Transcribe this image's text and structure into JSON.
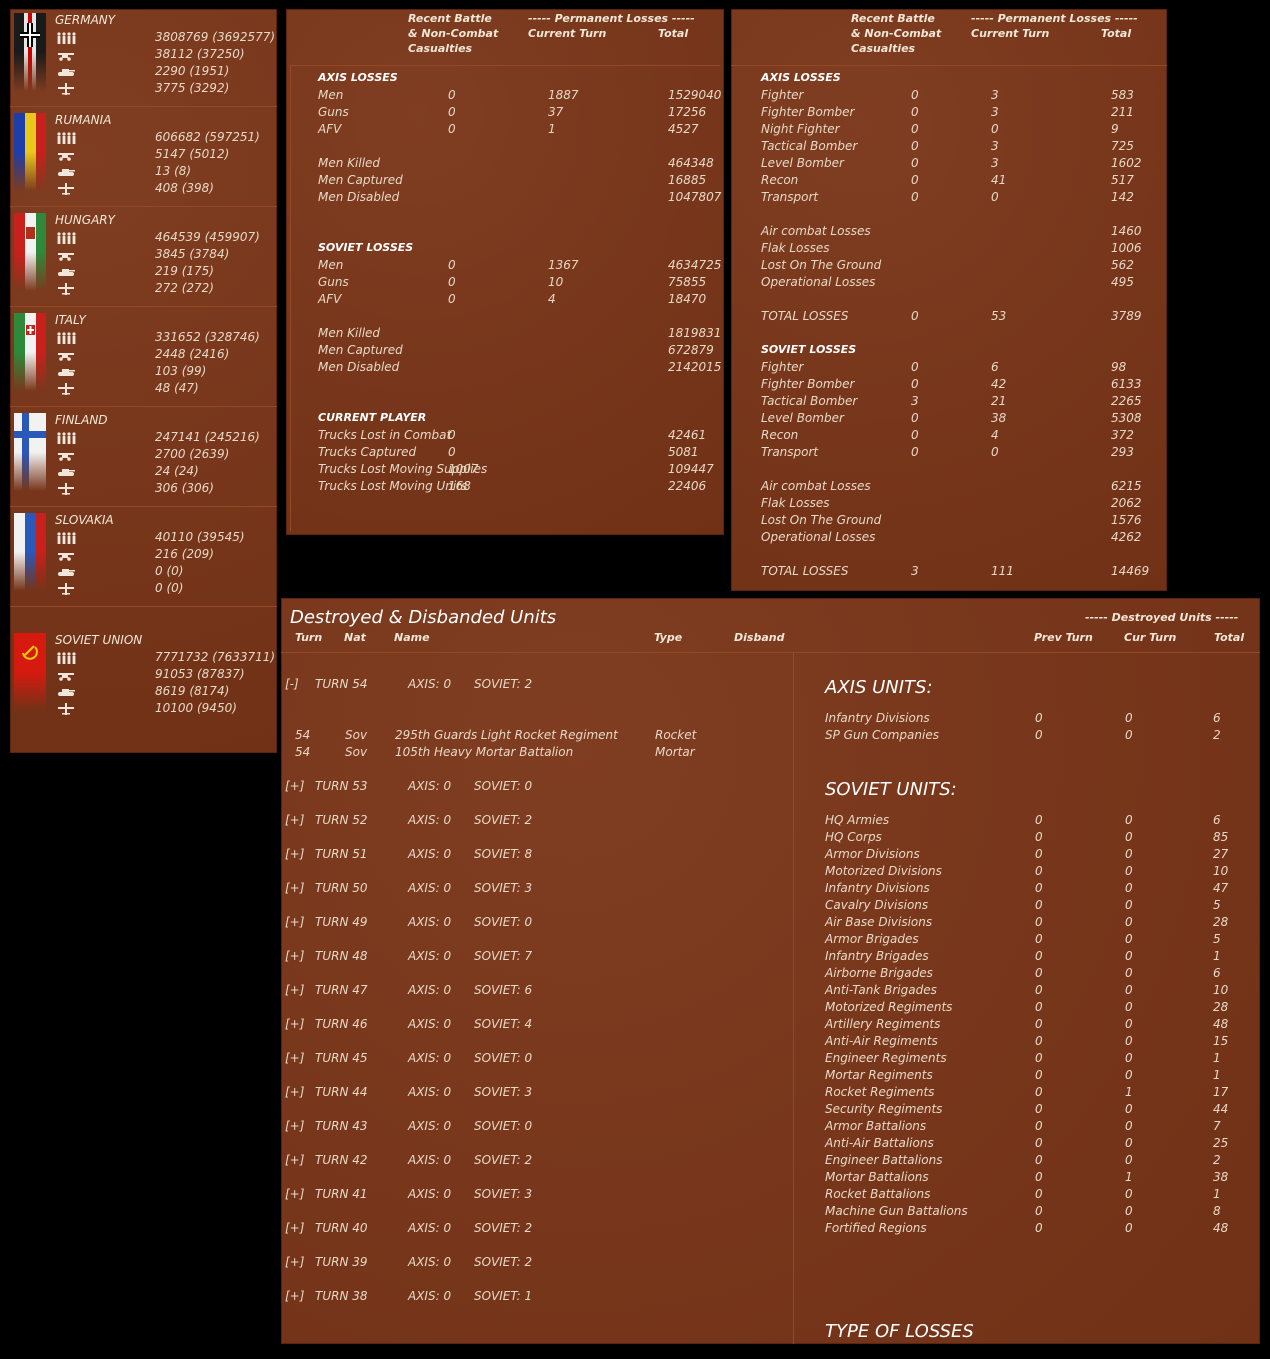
{
  "nations": [
    {
      "name": "GERMANY",
      "values": [
        "3808769 (3692577)",
        "38112 (37250)",
        "2290 (1951)",
        "3775 (3292)"
      ]
    },
    {
      "name": "RUMANIA",
      "values": [
        "606682 (597251)",
        "5147 (5012)",
        "13 (8)",
        "408 (398)"
      ]
    },
    {
      "name": "HUNGARY",
      "values": [
        "464539 (459907)",
        "3845 (3784)",
        "219 (175)",
        "272 (272)"
      ]
    },
    {
      "name": "ITALY",
      "values": [
        "331652 (328746)",
        "2448 (2416)",
        "103 (99)",
        "48 (47)"
      ]
    },
    {
      "name": "FINLAND",
      "values": [
        "247141 (245216)",
        "2700 (2639)",
        "24 (24)",
        "306 (306)"
      ]
    },
    {
      "name": "SLOVAKIA",
      "values": [
        "40110 (39545)",
        "216 (209)",
        "0 (0)",
        "0 (0)"
      ]
    },
    {
      "name": "SOVIET UNION",
      "values": [
        "7771732 (7633711)",
        "91053 (87837)",
        "8619 (8174)",
        "10100 (9450)"
      ]
    }
  ],
  "icons": [
    "infantry-icon",
    "gun-icon",
    "tank-icon",
    "aircraft-icon"
  ],
  "ground": {
    "col1a": "Recent Battle",
    "col1b": "& Non-Combat",
    "col1c": "Casualties",
    "perm": "----- Permanent Losses -----",
    "col2": "Current Turn",
    "col3": "Total",
    "sections": [
      {
        "title": "AXIS LOSSES",
        "rows": [
          [
            "Men",
            "0",
            "1887",
            "1529040"
          ],
          [
            "Guns",
            "0",
            "37",
            "17256"
          ],
          [
            "AFV",
            "0",
            "1",
            "4527"
          ]
        ],
        "rows2": [
          [
            "Men Killed",
            "",
            "",
            "464348"
          ],
          [
            "Men Captured",
            "",
            "",
            "16885"
          ],
          [
            "Men Disabled",
            "",
            "",
            "1047807"
          ]
        ]
      },
      {
        "title": "SOVIET LOSSES",
        "rows": [
          [
            "Men",
            "0",
            "1367",
            "4634725"
          ],
          [
            "Guns",
            "0",
            "10",
            "75855"
          ],
          [
            "AFV",
            "0",
            "4",
            "18470"
          ]
        ],
        "rows2": [
          [
            "Men Killed",
            "",
            "",
            "1819831"
          ],
          [
            "Men Captured",
            "",
            "",
            "672879"
          ],
          [
            "Men Disabled",
            "",
            "",
            "2142015"
          ]
        ]
      },
      {
        "title": "CURRENT PLAYER",
        "rows": [
          [
            "Trucks Lost in Combat",
            "0",
            "",
            "42461"
          ],
          [
            "Trucks Captured",
            "0",
            "",
            "5081"
          ],
          [
            "Trucks Lost Moving Supplies",
            "1007",
            "",
            "109447"
          ],
          [
            "Trucks Lost Moving Units",
            "168",
            "",
            "22406"
          ]
        ]
      }
    ]
  },
  "air": {
    "col1a": "Recent Battle",
    "col1b": "& Non-Combat",
    "col1c": "Casualties",
    "perm": "----- Permanent Losses -----",
    "col2": "Current Turn",
    "col3": "Total",
    "axis_title": "AXIS LOSSES",
    "axis_rows": [
      [
        "Fighter",
        "0",
        "3",
        "583"
      ],
      [
        "Fighter Bomber",
        "0",
        "3",
        "211"
      ],
      [
        "Night Fighter",
        "0",
        "0",
        "9"
      ],
      [
        "Tactical Bomber",
        "0",
        "3",
        "725"
      ],
      [
        "Level Bomber",
        "0",
        "3",
        "1602"
      ],
      [
        "Recon",
        "0",
        "41",
        "517"
      ],
      [
        "Transport",
        "0",
        "0",
        "142"
      ]
    ],
    "axis_rows2": [
      [
        "Air combat Losses",
        "",
        "",
        "1460"
      ],
      [
        "Flak Losses",
        "",
        "",
        "1006"
      ],
      [
        "Lost On The Ground",
        "",
        "",
        "562"
      ],
      [
        "Operational Losses",
        "",
        "",
        "495"
      ]
    ],
    "axis_total": [
      "TOTAL LOSSES",
      "0",
      "53",
      "3789"
    ],
    "soviet_title": "SOVIET LOSSES",
    "soviet_rows": [
      [
        "Fighter",
        "0",
        "6",
        "98"
      ],
      [
        "Fighter Bomber",
        "0",
        "42",
        "6133"
      ],
      [
        "Tactical Bomber",
        "3",
        "21",
        "2265"
      ],
      [
        "Level Bomber",
        "0",
        "38",
        "5308"
      ],
      [
        "Recon",
        "0",
        "4",
        "372"
      ],
      [
        "Transport",
        "0",
        "0",
        "293"
      ]
    ],
    "soviet_rows2": [
      [
        "Air combat Losses",
        "",
        "",
        "6215"
      ],
      [
        "Flak Losses",
        "",
        "",
        "2062"
      ],
      [
        "Lost On The Ground",
        "",
        "",
        "1576"
      ],
      [
        "Operational Losses",
        "",
        "",
        "4262"
      ]
    ],
    "soviet_total": [
      "TOTAL LOSSES",
      "3",
      "111",
      "14469"
    ]
  },
  "units": {
    "title": "Destroyed & Disbanded Units",
    "destroyed_header": "----- Destroyed Units -----",
    "headers": {
      "turn": "Turn",
      "nat": "Nat",
      "name": "Name",
      "type": "Type",
      "disband": "Disband",
      "prev": "Prev Turn",
      "cur": "Cur Turn",
      "total": "Total"
    },
    "expanded": {
      "toggle": "[-]",
      "label": "TURN 54",
      "axis": "AXIS: 0",
      "soviet": "SOVIET: 2"
    },
    "detail": [
      [
        "54",
        "Sov",
        "295th Guards Light Rocket Regiment",
        "Rocket"
      ],
      [
        "54",
        "Sov",
        "105th Heavy Mortar Battalion",
        "Mortar"
      ]
    ],
    "turns": [
      [
        "[+]",
        "TURN 53",
        "AXIS: 0",
        "SOVIET: 0"
      ],
      [
        "[+]",
        "TURN 52",
        "AXIS: 0",
        "SOVIET: 2"
      ],
      [
        "[+]",
        "TURN 51",
        "AXIS: 0",
        "SOVIET: 8"
      ],
      [
        "[+]",
        "TURN 50",
        "AXIS: 0",
        "SOVIET: 3"
      ],
      [
        "[+]",
        "TURN 49",
        "AXIS: 0",
        "SOVIET: 0"
      ],
      [
        "[+]",
        "TURN 48",
        "AXIS: 0",
        "SOVIET: 7"
      ],
      [
        "[+]",
        "TURN 47",
        "AXIS: 0",
        "SOVIET: 6"
      ],
      [
        "[+]",
        "TURN 46",
        "AXIS: 0",
        "SOVIET: 4"
      ],
      [
        "[+]",
        "TURN 45",
        "AXIS: 0",
        "SOVIET: 0"
      ],
      [
        "[+]",
        "TURN 44",
        "AXIS: 0",
        "SOVIET: 3"
      ],
      [
        "[+]",
        "TURN 43",
        "AXIS: 0",
        "SOVIET: 0"
      ],
      [
        "[+]",
        "TURN 42",
        "AXIS: 0",
        "SOVIET: 2"
      ],
      [
        "[+]",
        "TURN 41",
        "AXIS: 0",
        "SOVIET: 3"
      ],
      [
        "[+]",
        "TURN 40",
        "AXIS: 0",
        "SOVIET: 2"
      ],
      [
        "[+]",
        "TURN 39",
        "AXIS: 0",
        "SOVIET: 2"
      ],
      [
        "[+]",
        "TURN 38",
        "AXIS: 0",
        "SOVIET: 1"
      ]
    ],
    "axis_units_title": "AXIS UNITS:",
    "axis_units": [
      [
        "Infantry Divisions",
        "0",
        "0",
        "6"
      ],
      [
        "SP Gun Companies",
        "0",
        "0",
        "2"
      ]
    ],
    "soviet_units_title": "SOVIET UNITS:",
    "soviet_units": [
      [
        "HQ Armies",
        "0",
        "0",
        "6"
      ],
      [
        "HQ Corps",
        "0",
        "0",
        "85"
      ],
      [
        "Armor Divisions",
        "0",
        "0",
        "27"
      ],
      [
        "Motorized Divisions",
        "0",
        "0",
        "10"
      ],
      [
        "Infantry Divisions",
        "0",
        "0",
        "47"
      ],
      [
        "Cavalry Divisions",
        "0",
        "0",
        "5"
      ],
      [
        "Air Base Divisions",
        "0",
        "0",
        "28"
      ],
      [
        "Armor Brigades",
        "0",
        "0",
        "5"
      ],
      [
        "Infantry Brigades",
        "0",
        "0",
        "1"
      ],
      [
        "Airborne Brigades",
        "0",
        "0",
        "6"
      ],
      [
        "Anti-Tank Brigades",
        "0",
        "0",
        "10"
      ],
      [
        "Motorized Regiments",
        "0",
        "0",
        "28"
      ],
      [
        "Artillery Regiments",
        "0",
        "0",
        "48"
      ],
      [
        "Anti-Air Regiments",
        "0",
        "0",
        "15"
      ],
      [
        "Engineer Regiments",
        "0",
        "0",
        "1"
      ],
      [
        "Mortar Regiments",
        "0",
        "0",
        "1"
      ],
      [
        "Rocket Regiments",
        "0",
        "1",
        "17"
      ],
      [
        "Security Regiments",
        "0",
        "0",
        "44"
      ],
      [
        "Armor Battalions",
        "0",
        "0",
        "7"
      ],
      [
        "Anti-Air Battalions",
        "0",
        "0",
        "25"
      ],
      [
        "Engineer Battalions",
        "0",
        "0",
        "2"
      ],
      [
        "Mortar Battalions",
        "0",
        "1",
        "38"
      ],
      [
        "Rocket Battalions",
        "0",
        "0",
        "1"
      ],
      [
        "Machine Gun Battalions",
        "0",
        "0",
        "8"
      ],
      [
        "Fortified Regions",
        "0",
        "0",
        "48"
      ]
    ],
    "type_of_losses": "TYPE OF LOSSES"
  }
}
